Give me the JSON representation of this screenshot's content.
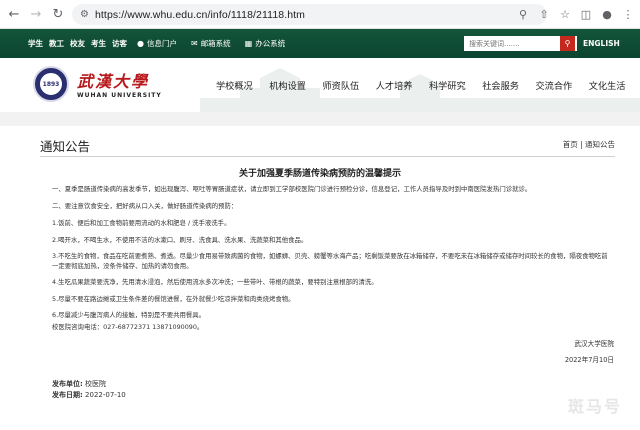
{
  "browser": {
    "url": "https://www.whu.edu.cn/info/1118/21118.htm",
    "back_icon": "arrow-left",
    "forward_icon": "arrow-right",
    "reload_icon": "reload"
  },
  "topstrip": {
    "quick_links": [
      "学生",
      "教工",
      "校友",
      "考生",
      "访客"
    ],
    "portal_links": [
      {
        "label": "信息门户",
        "icon": "user-icon"
      },
      {
        "label": "邮箱系统",
        "icon": "mail-icon"
      },
      {
        "label": "办公系统",
        "icon": "office-icon"
      }
    ],
    "search_placeholder": "搜索关键词.......",
    "lang": "ENGLISH"
  },
  "header": {
    "brand_cn": "武漢大學",
    "brand_en": "WUHAN UNIVERSITY",
    "seal_text": "1893",
    "nav": [
      "学校概况",
      "机构设置",
      "师资队伍",
      "人才培养",
      "科学研究",
      "社会服务",
      "交流合作",
      "文化生活"
    ]
  },
  "section": {
    "title": "通知公告",
    "breadcrumb": "首页 | 通知公告"
  },
  "article": {
    "title": "关于加强夏季肠道传染病预防的温馨提示",
    "paragraphs": [
      "一、夏季是肠道传染病的高发季节，如出现腹泻、呕吐等胃肠道症状，请立即到工学部校医院门诊进行预检分诊，信息登记，工作人员指导及时到中南医院发热门诊就诊。",
      "二、要注意饮食安全，把好病从口入关，做好肠道传染病的预防：",
      "1.饭前、便后和加工食物前要用流动的水和肥皂 / 洗手液洗手。",
      "2.喝开水，不喝生水，不使用不洁的水漱口、刷牙、洗食具、洗水果、洗蔬菜和其他食品。",
      "3.不吃生的食物，食品在吃前要煮熟、煮透。尽量少食用易带致病菌的食物，如螺蛳、贝壳、螃蟹等水海产品；吃剩饭菜要放在冰箱储存，不要吃未在冰箱储存或储存时间较长的食物，隔夜食物吃前一定要彻底加热，没条件储存、加热的请勿食用。",
      "4.生吃瓜果蔬菜要洗净，先用清水浸泡，然后使用流水多次冲洗；一些带叶、带根的蔬菜，要特别注意根部的清洗。",
      "5.尽量不要在路边摊或卫生条件差的餐馆进餐，在外就餐少吃凉拌菜和肉类烧烤食物。",
      "6.尽量减少与腹泻病人的接触，特别是不要共用餐具。",
      "校医院咨询电话：027-68772371  13871090090。"
    ],
    "signature": "武汉大学医院",
    "date": "2022年7月10日"
  },
  "meta": {
    "publisher_label": "发布单位:",
    "publisher": "校医院",
    "date_label": "发布日期:",
    "date": "2022-07-10"
  },
  "watermark": "斑马号"
}
